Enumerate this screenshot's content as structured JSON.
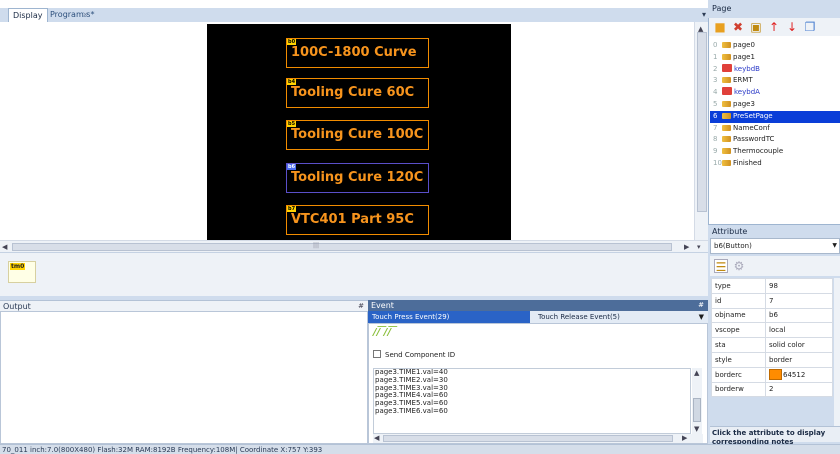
{
  "display": {
    "tabs": [
      {
        "label": "Display",
        "active": true
      },
      {
        "label": "Program.s*",
        "active": false
      }
    ],
    "close_glyph": "×",
    "dropdown_glyph": "▾",
    "scroll_marker": "|||",
    "hmi_buttons": [
      {
        "tag": "b0",
        "label": "100C-1800 Curve",
        "selected": false
      },
      {
        "tag": "b4",
        "label": "Tooling Cure 60C",
        "selected": false
      },
      {
        "tag": "b5",
        "label": "Tooling Cure 100C",
        "selected": false
      },
      {
        "tag": "b6",
        "label": "Tooling Cure 120C",
        "selected": true
      },
      {
        "tag": "b7",
        "label": "VTC401 Part 95C",
        "selected": false
      }
    ],
    "timer_tag": "tm0",
    "colors": {
      "button_border": "#f28c00",
      "button_text": "#f7941d",
      "selected_border": "#5a4fc9",
      "canvas": "#000000"
    }
  },
  "page_panel": {
    "title": "Page",
    "toolbar_icons": [
      "add-page-icon",
      "delete-page-icon",
      "insert-page-icon",
      "move-up-icon",
      "move-down-icon",
      "copy-page-icon"
    ],
    "pages": [
      {
        "num": "0",
        "label": "page0",
        "locked": false,
        "selected": false
      },
      {
        "num": "1",
        "label": "page1",
        "locked": false,
        "selected": false
      },
      {
        "num": "2",
        "label": "keybdB",
        "locked": true,
        "selected": false
      },
      {
        "num": "3",
        "label": "ERMT",
        "locked": false,
        "selected": false
      },
      {
        "num": "4",
        "label": "keybdA",
        "locked": true,
        "selected": false
      },
      {
        "num": "5",
        "label": "page3",
        "locked": false,
        "selected": false
      },
      {
        "num": "6",
        "label": "PreSetPage",
        "locked": false,
        "selected": true
      },
      {
        "num": "7",
        "label": "NameConf",
        "locked": false,
        "selected": false
      },
      {
        "num": "8",
        "label": "PasswordTC",
        "locked": false,
        "selected": false
      },
      {
        "num": "9",
        "label": "Thermocouple",
        "locked": false,
        "selected": false
      },
      {
        "num": "10",
        "label": "Finished",
        "locked": false,
        "selected": false
      }
    ]
  },
  "attribute_panel": {
    "title": "Attribute",
    "selected_component": "b6(Button)",
    "rows": [
      {
        "key": "type",
        "value": "98"
      },
      {
        "key": "id",
        "value": "7"
      },
      {
        "key": "objname",
        "value": "b6"
      },
      {
        "key": "vscope",
        "value": "local"
      },
      {
        "key": "sta",
        "value": "solid color"
      },
      {
        "key": "style",
        "value": "border"
      },
      {
        "key": "borderc",
        "value": "64512",
        "swatch": "#ff8c00"
      },
      {
        "key": "borderw",
        "value": "2"
      }
    ],
    "note": "Click the attribute to display corresponding notes"
  },
  "output": {
    "title": "Output",
    "pin": "#"
  },
  "event": {
    "title": "Event",
    "pin": "#",
    "tab_active": "Touch Press Event(29)",
    "tab_other": "Touch Release Event(5)",
    "send_component_label": "Send Component ID",
    "code_lines": [
      "page3.TIME1.val=40",
      "page3.TIME2.val=30",
      "page3.TIME3.val=30",
      "page3.TIME4.val=60",
      "page3.TIME5.val=60",
      "page3.TIME6.val=60"
    ]
  },
  "statusbar": {
    "text": "70_011 inch:7.0(800X480) Flash:32M RAM:8192B Frequency:108M|   Coordinate X:757  Y:393"
  }
}
